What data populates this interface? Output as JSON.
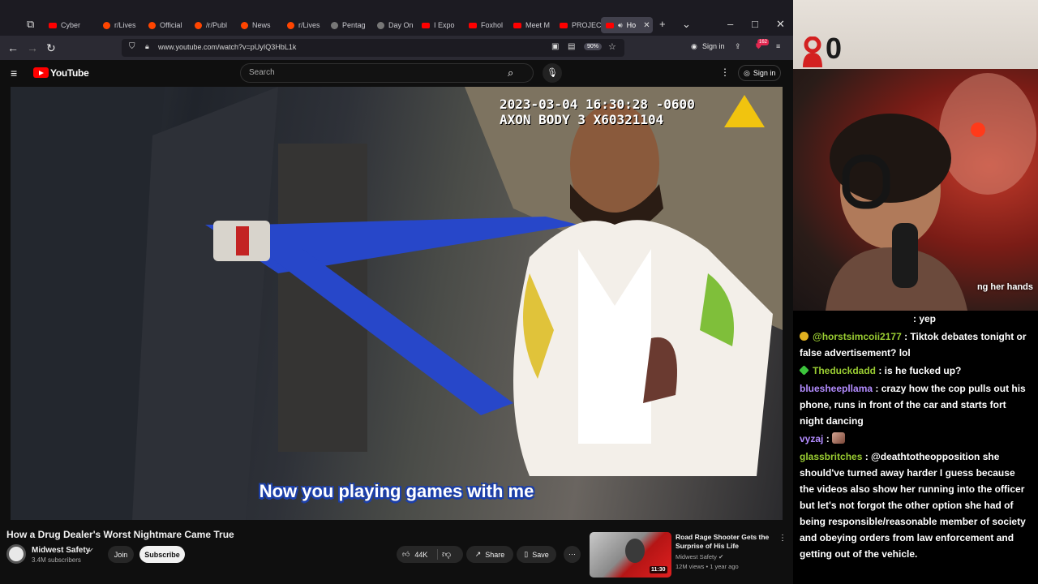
{
  "browser": {
    "tabs": [
      {
        "label": "Cyber",
        "type": "youtube"
      },
      {
        "label": "r/Lives",
        "type": "reddit"
      },
      {
        "label": "Official",
        "type": "reddit"
      },
      {
        "label": "/r/Publ",
        "type": "reddit"
      },
      {
        "label": "News",
        "type": "reddit"
      },
      {
        "label": "r/Lives",
        "type": "reddit"
      },
      {
        "label": "Pentag",
        "type": "gray"
      },
      {
        "label": "Day On",
        "type": "gray"
      },
      {
        "label": "I Expo",
        "type": "youtube"
      },
      {
        "label": "Foxhol",
        "type": "youtube"
      },
      {
        "label": "Meet M",
        "type": "youtube"
      },
      {
        "label": "PROJEC",
        "type": "youtube"
      },
      {
        "label": "Ho",
        "type": "youtube",
        "active": true
      }
    ],
    "url": "www.youtube.com/watch?v=pUyIQ3HbL1k",
    "zoom": "90%",
    "sign_in": "Sign in",
    "badge_count": "162"
  },
  "youtube": {
    "logo": "YouTube",
    "search_placeholder": "Search",
    "sign_in": "Sign in"
  },
  "video": {
    "overlay_timestamp": "2023-03-04 16:30:28 -0600",
    "overlay_device": "AXON BODY 3 X60321104",
    "caption": "Now you playing games with me",
    "title": "How a Drug Dealer's Worst Nightmare Came True",
    "channel": "Midwest Safety",
    "subscribers": "3.4M subscribers",
    "join": "Join",
    "subscribe": "Subscribe",
    "likes": "44K",
    "share": "Share",
    "save": "Save"
  },
  "related": {
    "title": "Road Rage Shooter Gets the Surprise of His Life",
    "channel": "Midwest Safety",
    "meta": "12M views • 1 year ago",
    "duration": "11:30"
  },
  "stream": {
    "counter": "0",
    "ticker_text": "ng her hands",
    "chat": [
      {
        "user": "",
        "text": ": yep",
        "color": "#ffffff"
      },
      {
        "user": "@horstsimcoii2177",
        "text": " : Tiktok debates tonight or false advertisement? lol",
        "color": "#9acd32",
        "badge": "gold"
      },
      {
        "user": "Theduckdadd",
        "text": " : is he fucked up?",
        "color": "#9acd32",
        "badge": "green"
      },
      {
        "user": "bluesheepllama",
        "text": " : crazy how the cop pulls out his phone, runs in front of the car and starts fort night dancing",
        "color": "#b38cff"
      },
      {
        "user": "vyzaj",
        "text": " : ",
        "color": "#b38cff",
        "emote": true
      },
      {
        "user": "glassbritches",
        "text": " : @deathtotheopposition she should've turned away harder I guess because the videos also show her running into the officer but let's not forgot the other option she had of being responsible/reasonable member of society and obeying orders from law enforcement and getting out of the vehicle.",
        "color": "#9acd32"
      }
    ]
  },
  "colors": {
    "youtube_red": "#ff0000",
    "caption_outline": "#1c3fa8"
  }
}
